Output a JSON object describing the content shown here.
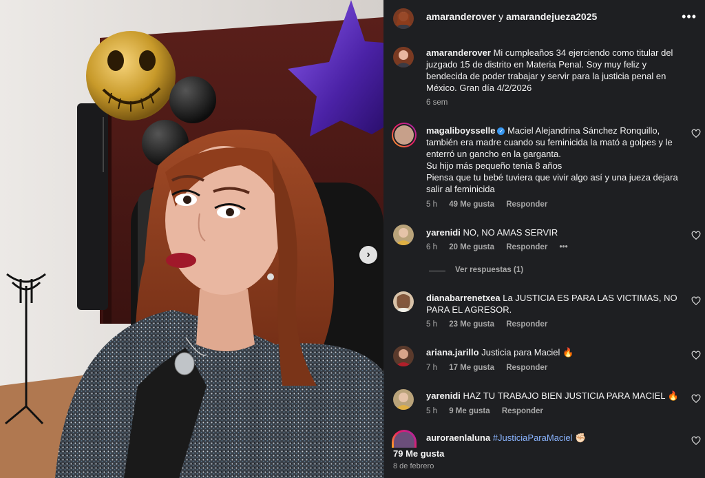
{
  "header": {
    "user1": "amaranderover",
    "joiner": "y",
    "user2": "amarandejueza2025",
    "more": "•••"
  },
  "caption": {
    "user": "amaranderover",
    "text": "Mi cumpleaños 34 ejerciendo como titular del juzgado 15 de distrito en Materia Penal. Soy muy feliz y bendecida de poder trabajar y servir para la justicia penal en México. Gran día 4/2/2026",
    "time": "6 sem"
  },
  "comments": [
    {
      "user": "magaliboysselle",
      "verified": "✓",
      "lines": [
        "Maciel Alejandrina Sánchez Ronquillo,",
        "también era madre cuando su feminicida la mató a golpes y le enterró un gancho en la garganta.",
        "Su hijo más pequeño tenía 8 años",
        "Piensa que tu bebé tuviera que vivir algo así y una jueza dejara salir al feminicida"
      ],
      "time": "5 h",
      "likes": "49 Me gusta",
      "reply": "Responder"
    },
    {
      "user": "yarenidi",
      "text": "NO, NO AMAS SERVIR",
      "time": "6 h",
      "likes": "20 Me gusta",
      "reply": "Responder",
      "more": "•••",
      "view_replies": "Ver respuestas (1)"
    },
    {
      "user": "dianabarrenetxea",
      "text": "La JUSTICIA ES PARA LAS VICTIMAS, NO PARA EL AGRESOR.",
      "time": "5 h",
      "likes": "23 Me gusta",
      "reply": "Responder"
    },
    {
      "user": "ariana.jarillo",
      "text": "Justicia para Maciel 🔥",
      "time": "7 h",
      "likes": "17 Me gusta",
      "reply": "Responder"
    },
    {
      "user": "yarenidi",
      "text": "HAZ TU TRABAJO BIEN JUSTICIA PARA MACIEL 🔥",
      "time": "5 h",
      "likes": "9 Me gusta",
      "reply": "Responder"
    },
    {
      "user": "auroraenlaluna",
      "hashtag": "#JusticiaParaMaciel",
      "emoji": "✊🏻"
    }
  ],
  "footer": {
    "likes": "79 Me gusta",
    "date": "8 de febrero"
  },
  "icons": {
    "next": "chevron-right-icon",
    "heart": "heart-outline-icon"
  },
  "colors": {
    "panel_bg": "#1e1f22",
    "muted": "#a8a8a8",
    "hashtag": "#8ab4ff",
    "verified": "#3897f0",
    "balloon_purple": "#5a2bb8",
    "balloon_gold": "#c89a2a"
  }
}
